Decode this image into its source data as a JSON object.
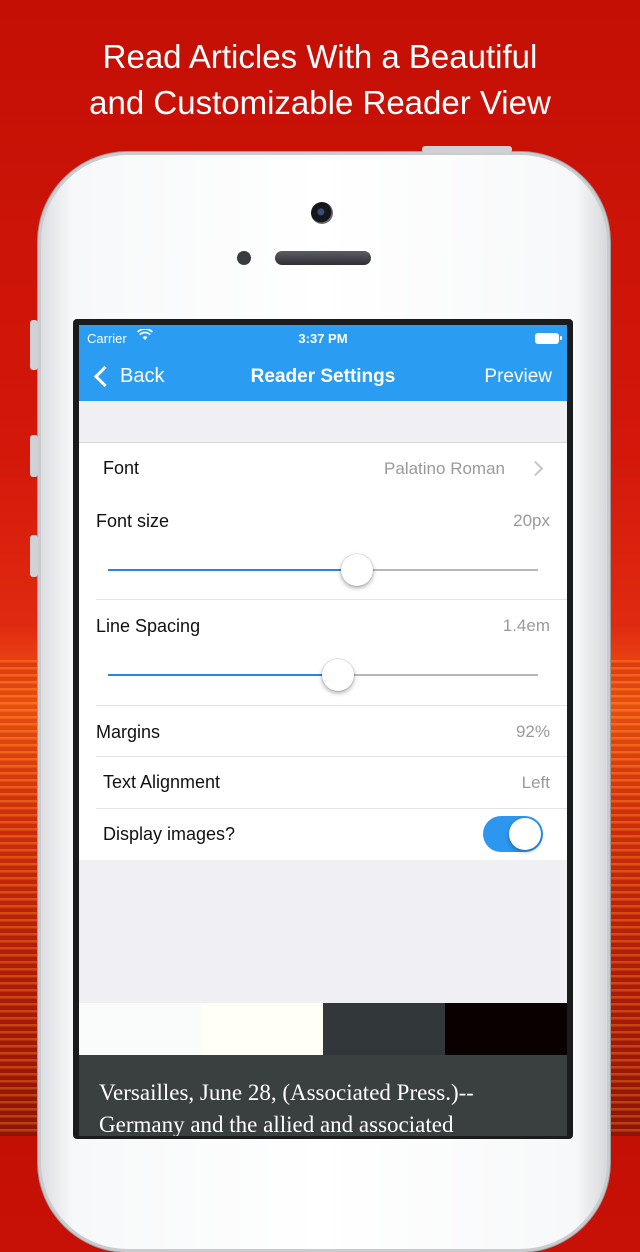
{
  "headline": {
    "line1": "Read Articles With a Beautiful",
    "line2": "and Customizable Reader View"
  },
  "statusbar": {
    "carrier": "Carrier",
    "time": "3:37 PM"
  },
  "navbar": {
    "back_label": "Back",
    "title": "Reader Settings",
    "preview_label": "Preview"
  },
  "settings": {
    "font": {
      "label": "Font",
      "value": "Palatino Roman"
    },
    "font_size": {
      "label": "Font size",
      "value": "20px",
      "slider_fraction": 0.58
    },
    "line_spacing": {
      "label": "Line Spacing",
      "value": "1.4em",
      "slider_fraction": 0.535
    },
    "margins": {
      "label": "Margins",
      "value": "92%"
    },
    "text_alignment": {
      "label": "Text Alignment",
      "value": "Left"
    },
    "display_images": {
      "label": "Display images?",
      "enabled": true
    }
  },
  "themes": {
    "swatch_colors": [
      "#fafbfb",
      "#fffff5",
      "#323839",
      "#0b0000"
    ]
  },
  "article": {
    "line1": "Versailles, June 28, (Associated Press.)--",
    "line2": "Germany and the allied and associated"
  },
  "colors": {
    "accent": "#2a9cf2",
    "toggle_on": "#2d96ee"
  }
}
